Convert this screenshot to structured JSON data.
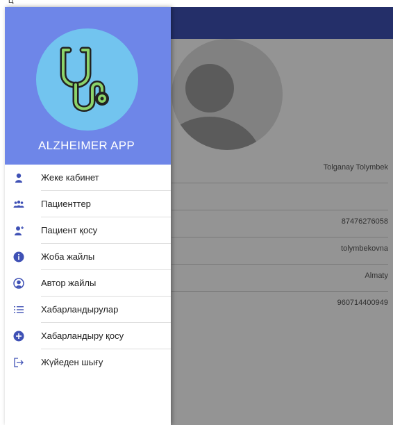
{
  "status_bar": {
    "label": "Ц"
  },
  "drawer": {
    "app_title": "ALZHEIMER APP",
    "accent_color": "#6e86e8",
    "logo_bg_color": "#72c4ef",
    "items": [
      {
        "label": "Жеке кабинет",
        "icon": "person-icon"
      },
      {
        "label": "Пациенттер",
        "icon": "group-icon"
      },
      {
        "label": "Пациент қосу",
        "icon": "add-person-icon"
      },
      {
        "label": "Жоба жайлы",
        "icon": "info-icon"
      },
      {
        "label": "Автор жайлы",
        "icon": "author-icon"
      },
      {
        "label": "Хабарландырулар",
        "icon": "list-icon"
      },
      {
        "label": "Хабарландыру қосу",
        "icon": "add-circle-icon"
      },
      {
        "label": "Жүйеден шығу",
        "icon": "logout-icon"
      }
    ]
  },
  "profile": {
    "appbar_color": "#3f51b5",
    "fields": [
      "Tolganay Tolymbek",
      "",
      "87476276058",
      "tolymbekovna",
      "Almaty",
      "960714400949"
    ]
  }
}
